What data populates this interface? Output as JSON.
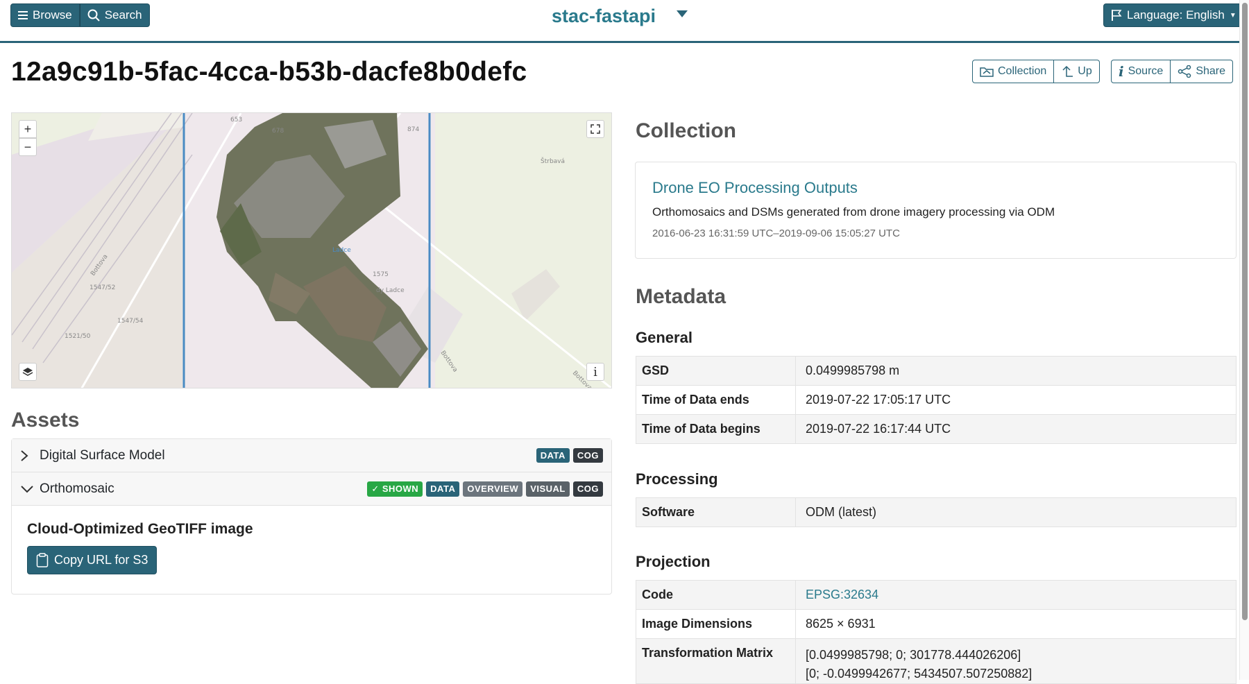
{
  "nav": {
    "browse_label": "Browse",
    "search_label": "Search",
    "brand": "stac-fastapi",
    "language_label": "Language: English"
  },
  "page": {
    "title": "12a9c91b-5fac-4cca-b53b-dacfe8b0defc"
  },
  "actions": {
    "collection_label": "Collection",
    "up_label": "Up",
    "source_label": "Source",
    "share_label": "Share"
  },
  "map": {
    "labels": [
      "Štrbavá",
      "Bottova",
      "Bottova",
      "Bottova",
      "1547/52",
      "1547/54",
      "1521/50",
      "Ladce",
      "1575",
      "dy Ladce",
      "653",
      "678",
      "874"
    ]
  },
  "assets": {
    "heading": "Assets",
    "items": [
      {
        "title": "Digital Surface Model",
        "expanded": false,
        "badges": [
          "DATA",
          "COG"
        ]
      },
      {
        "title": "Orthomosaic",
        "expanded": true,
        "badges": [
          "SHOWN",
          "DATA",
          "OVERVIEW",
          "VISUAL",
          "COG"
        ],
        "body_title": "Cloud-Optimized GeoTIFF image",
        "copy_label": "Copy URL for S3"
      }
    ]
  },
  "collection": {
    "heading": "Collection",
    "title": "Drone EO Processing Outputs",
    "description": "Orthomosaics and DSMs generated from drone imagery processing via ODM",
    "date_range": "2016-06-23 16:31:59 UTC–2019-09-06 15:05:27 UTC"
  },
  "metadata": {
    "heading": "Metadata",
    "general": {
      "heading": "General",
      "rows": [
        {
          "key": "GSD",
          "value": "0.0499985798 m"
        },
        {
          "key": "Time of Data ends",
          "value": "2019-07-22 17:05:17 UTC"
        },
        {
          "key": "Time of Data begins",
          "value": "2019-07-22 16:17:44 UTC"
        }
      ]
    },
    "processing": {
      "heading": "Processing",
      "rows": [
        {
          "key": "Software",
          "value": "ODM (latest)"
        }
      ]
    },
    "projection": {
      "heading": "Projection",
      "rows": [
        {
          "key": "Code",
          "value": "EPSG:32634"
        },
        {
          "key": "Image Dimensions",
          "value": "8625 × 6931"
        },
        {
          "key": "Transformation Matrix",
          "value": "[0.0499985798; 0; 301778.444026206]",
          "value2": "[0; -0.0499942677; 5434507.507250882]"
        }
      ]
    }
  },
  "colors": {
    "accent": "#2a6478",
    "link": "#2a7a8c",
    "shown": "#28a745"
  }
}
